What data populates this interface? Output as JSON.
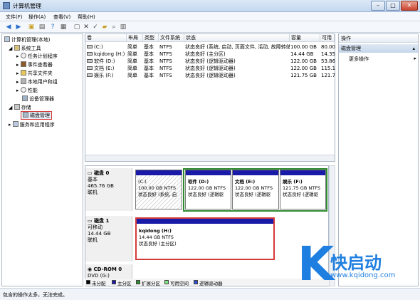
{
  "window": {
    "title": "计算机管理"
  },
  "menu": [
    "文件(F)",
    "操作(A)",
    "查看(V)",
    "帮助(H)"
  ],
  "tree": [
    {
      "label": "计算机管理(本地)",
      "level": 0
    },
    {
      "label": "系统工具",
      "level": 1
    },
    {
      "label": "任务计划程序",
      "level": 2
    },
    {
      "label": "事件查看器",
      "level": 2
    },
    {
      "label": "共享文件夹",
      "level": 2
    },
    {
      "label": "本地用户和组",
      "level": 2
    },
    {
      "label": "性能",
      "level": 2
    },
    {
      "label": "设备管理器",
      "level": 2
    },
    {
      "label": "存储",
      "level": 1
    },
    {
      "label": "磁盘管理",
      "level": 2,
      "selected": true
    },
    {
      "label": "服务和应用程序",
      "level": 1
    }
  ],
  "volume_table": {
    "headers": [
      "卷",
      "布局",
      "类型",
      "文件系统",
      "状态",
      "容量",
      "可用"
    ],
    "rows": [
      [
        "(C:)",
        "简单",
        "基本",
        "NTFS",
        "状态良好 (系统, 启动, 页面文件, 活动, 故障转储, 主分区)",
        "100.00 GB",
        "80.00"
      ],
      [
        "kqidong (H:)",
        "简单",
        "基本",
        "NTFS",
        "状态良好 (主分区)",
        "14.44 GB",
        "14.35"
      ],
      [
        "软件 (D:)",
        "简单",
        "基本",
        "NTFS",
        "状态良好 (逻辑驱动器)",
        "122.00 GB",
        "53.86"
      ],
      [
        "文档 (E:)",
        "简单",
        "基本",
        "NTFS",
        "状态良好 (逻辑驱动器)",
        "122.00 GB",
        "115.1"
      ],
      [
        "娱乐 (F:)",
        "简单",
        "基本",
        "NTFS",
        "状态良好 (逻辑驱动器)",
        "121.75 GB",
        "121.7"
      ]
    ]
  },
  "disks": [
    {
      "name": "磁盘 0",
      "type": "基本",
      "size": "465.76 GB",
      "state": "联机",
      "partitions": [
        {
          "name": "(C:)",
          "size": "100.00 GB NTFS",
          "status": "状态良好 (系统, 启"
        },
        {
          "name": "软件 (D:)",
          "size": "122.00 GB NTFS",
          "status": "状态良好 (逻辑驱"
        },
        {
          "name": "文档 (E:)",
          "size": "122.00 GB NTFS",
          "status": "状态良好 (逻辑驱"
        },
        {
          "name": "娱乐 (F:)",
          "size": "121.75 GB NTFS",
          "status": "状态良好 (逻辑驱"
        }
      ]
    },
    {
      "name": "磁盘 1",
      "type": "可移动",
      "size": "14.44 GB",
      "state": "联机",
      "partitions": [
        {
          "name": "kqidong (H:)",
          "size": "14.44 GB NTFS",
          "status": "状态良好 (主分区)"
        }
      ]
    },
    {
      "name": "CD-ROM 0",
      "type": "DVD (G:)"
    }
  ],
  "legend": [
    "未分配",
    "主分区",
    "扩展分区",
    "可用空间",
    "逻辑驱动器"
  ],
  "colors": {
    "unallocated": "#000000",
    "primary": "#1a1aa8",
    "extended": "#2e8b2e",
    "free": "#7fe07f",
    "logical": "#2f4fd0",
    "highlight": "#d43b3b"
  },
  "actions": {
    "header": "操作",
    "section": "磁盘管理",
    "more": "更多操作"
  },
  "status": "包含的操作太多，无法完成。",
  "watermark": {
    "letter": "K",
    "brand": "快启动",
    "url": "www.kqidong.com"
  }
}
